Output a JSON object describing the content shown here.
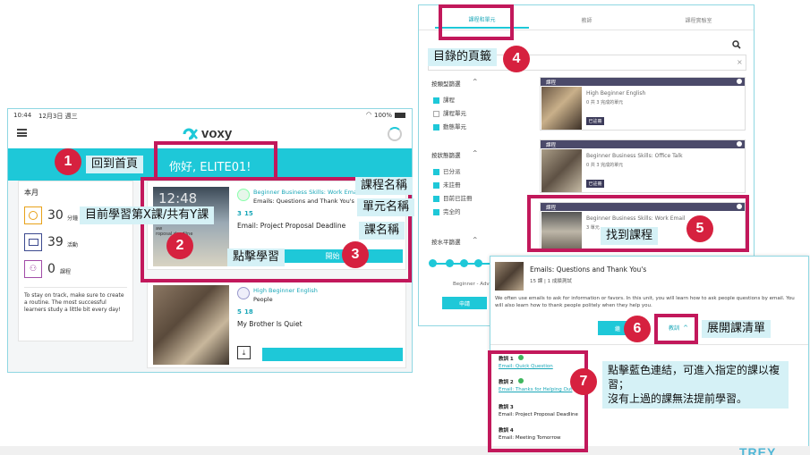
{
  "tablet": {
    "status_time": "10:44",
    "status_date": "12月3日 週三",
    "battery": "100%",
    "logo": "voxy",
    "greeting": "你好, ELITE01!",
    "sidebar": {
      "title": "本月",
      "stats": [
        {
          "value": "30",
          "label": "分鐘",
          "icon": "clock-icon",
          "color": "#e8a21a"
        },
        {
          "value": "39",
          "label": "活動",
          "icon": "activity-icon",
          "color": "#3d4a8f"
        },
        {
          "value": "0",
          "label": "課程",
          "icon": "group-icon",
          "color": "#a24ca8"
        }
      ],
      "tip": "To stay on track, make sure to create a routine. The most successful learners study a little bit every day!"
    },
    "card1": {
      "course": "Beginner Business Skills: Work Email",
      "unit": "Emails: Questions and Thank You's",
      "progress_current": "3",
      "progress_total": "15",
      "lesson": "Email: Project Proposal Deadline",
      "start_label": "開始",
      "clock_text": "12:48",
      "photo_text": "aw\nroposal deadline"
    },
    "card2": {
      "course": "High Beginner English",
      "unit": "People",
      "progress_current": "5",
      "progress_total": "18",
      "lesson": "My Brother Is Quiet"
    }
  },
  "web": {
    "tabs": [
      "課程和單元",
      "教師",
      "課程實驗室"
    ],
    "filters": [
      {
        "title": "按類型篩選",
        "items": [
          {
            "label": "課程",
            "checked": true
          },
          {
            "label": "課程單元",
            "checked": false
          },
          {
            "label": "動態單元",
            "checked": true
          }
        ]
      },
      {
        "title": "按狀態篩選",
        "items": [
          {
            "label": "已分派",
            "checked": true
          },
          {
            "label": "未註冊",
            "checked": true
          },
          {
            "label": "目前已註冊",
            "checked": true
          },
          {
            "label": "完全的",
            "checked": true
          }
        ]
      },
      {
        "title": "按水平篩選",
        "items": []
      }
    ],
    "level_caption": "Beginner - Adv",
    "apply_label": "申請",
    "catalog": [
      {
        "tag": "課程",
        "name": "High Beginner English",
        "meta": "0 共 3 完成的單元",
        "button": "已註冊"
      },
      {
        "tag": "課程",
        "name": "Beginner Business Skills: Office Talk",
        "meta": "0 共 3 完成的單元",
        "button": "已註冊"
      },
      {
        "tag": "課程",
        "name": "Beginner Business Skills: Work Email",
        "meta": "3 單元"
      }
    ],
    "detail": {
      "title": "Emails: Questions and Thank You's",
      "meta": "15 課 | 1 成績測試",
      "desc": "We often use emails to ask for information or favors. In this unit, you will learn how to ask people questions by email. You will also learn how to thank people politely when they help you.",
      "left_button": "繼",
      "lessons_label": "教訓",
      "lessons": [
        {
          "num": "教訓 1",
          "title": "Email: Quick Question",
          "done": true
        },
        {
          "num": "教訓 2",
          "title": "Email: Thanks for Helping Out",
          "done": true
        },
        {
          "num": "教訓 3",
          "title": "Email: Project Proposal Deadline",
          "done": false
        },
        {
          "num": "教訓 4",
          "title": "Email: Meeting Tomorrow",
          "done": false
        }
      ]
    }
  },
  "annotations": {
    "n1": "1",
    "c1": "回到首頁",
    "n2": "2",
    "c2": "目前學習第X課/共有Y課",
    "n3": "3",
    "c3": "點擊學習",
    "c_course": "課程名稱",
    "c_unit": "單元名稱",
    "c_lesson": "課名稱",
    "n4": "4",
    "c4": "目錄的頁籤",
    "n5": "5",
    "c5": "找到課程",
    "n6": "6",
    "c6": "展開課清單",
    "n7": "7",
    "c7": "點擊藍色連結，可進入指定的課以複習；\n沒有上過的課無法提前學習。"
  },
  "footer_logo": "TREY"
}
